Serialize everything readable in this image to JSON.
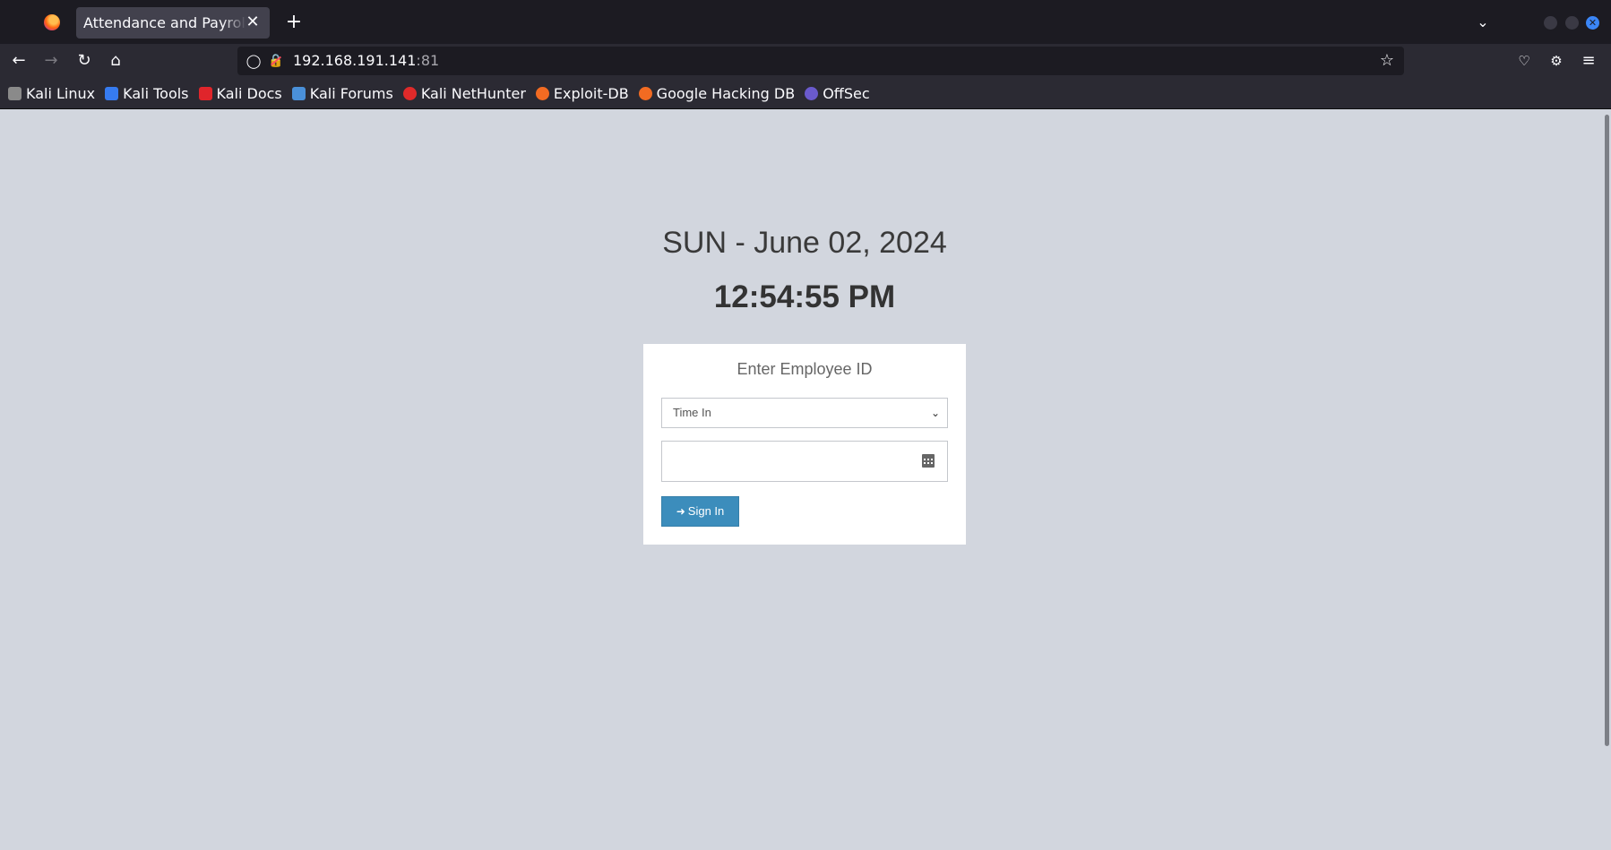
{
  "browser": {
    "tab_title": "Attendance and Payroll System",
    "tab_close": "✕",
    "new_tab": "+",
    "url_host": "192.168.191.141",
    "url_port": ":81",
    "bookmarks": [
      {
        "label": "Kali Linux",
        "icon": "kali-dragon-icon",
        "color": "#1c1b22"
      },
      {
        "label": "Kali Tools",
        "icon": "kali-tools-icon",
        "color": "#367bf0"
      },
      {
        "label": "Kali Docs",
        "icon": "kali-docs-icon",
        "color": "#e0252b"
      },
      {
        "label": "Kali Forums",
        "icon": "kali-forums-icon",
        "color": "#4a90d9"
      },
      {
        "label": "Kali NetHunter",
        "icon": "nethunter-icon",
        "color": "#e02a2a"
      },
      {
        "label": "Exploit-DB",
        "icon": "exploit-db-icon",
        "color": "#f26b22"
      },
      {
        "label": "Google Hacking DB",
        "icon": "ghdb-icon",
        "color": "#f26b22"
      },
      {
        "label": "OffSec",
        "icon": "offsec-icon",
        "color": "#6a5acd"
      }
    ]
  },
  "page": {
    "date": "SUN - June 02, 2024",
    "time": "12:54:55 PM",
    "login_message": "Enter Employee ID",
    "status_selected": "Time In",
    "employee_placeholder": "",
    "signin_label": "Sign In"
  },
  "colors": {
    "page_bg": "#d2d6de",
    "button_bg": "#3c8dbc"
  }
}
